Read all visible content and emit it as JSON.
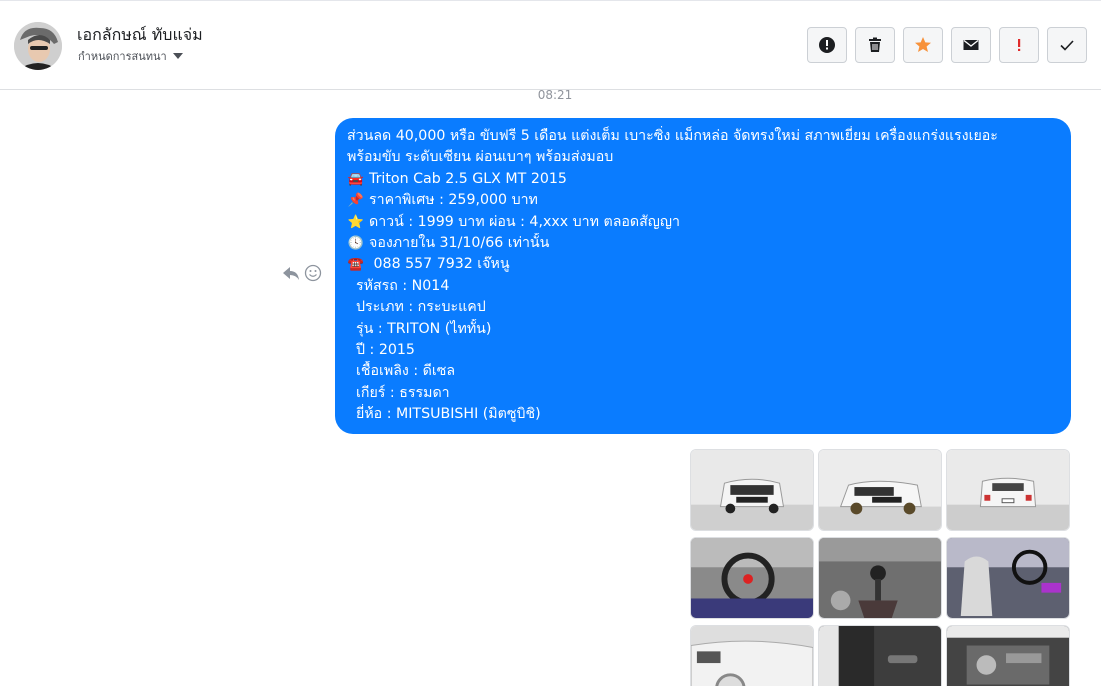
{
  "header": {
    "name": "เอกลักษณ์ ทับแจ่ม",
    "subtitle": "กำหนดการสนทนา"
  },
  "actions": [
    {
      "icon": "alert-circle-icon"
    },
    {
      "icon": "trash-icon"
    },
    {
      "icon": "star-icon",
      "color": "#f7923b"
    },
    {
      "icon": "mail-icon"
    },
    {
      "icon": "important-icon",
      "color": "#e02b2b"
    },
    {
      "icon": "check-icon"
    }
  ],
  "conversation": {
    "time": "08:21",
    "message": {
      "lines": [
        {
          "emoji": "",
          "text": "ส่วนลด 40,000 หรือ ขับฟรี 5 เดือน แต่งเต็ม เบาะซิ่ง แม็กหล่อ จัดทรงใหม่ สภาพเยี่ยม เครื่องแกร่งแรงเยอะ"
        },
        {
          "emoji": "",
          "text": "พร้อมขับ ระดับเซียน ผ่อนเบาๆ พร้อมส่งมอบ"
        },
        {
          "emoji": "🚘",
          "text": "Triton Cab 2.5 GLX MT 2015"
        },
        {
          "emoji": "📌",
          "text": "ราคาพิเศษ : 259,000 บาท"
        },
        {
          "emoji": "⭐",
          "text": "ดาวน์ : 1999 บาท ผ่อน : 4,xxx บาท ตลอดสัญญา"
        },
        {
          "emoji": "🕓",
          "text": "จองภายใน 31/10/66 เท่านั้น"
        },
        {
          "emoji": "☎️",
          "text": " 088 557 7932 เจ๊หนู"
        },
        {
          "emoji": "",
          "text": "  รหัสรถ : N014"
        },
        {
          "emoji": "",
          "text": "  ประเภท : กระบะแคป"
        },
        {
          "emoji": "",
          "text": "  รุ่น : TRITON (ไททั้น)"
        },
        {
          "emoji": "",
          "text": "  ปี : 2015"
        },
        {
          "emoji": "",
          "text": "  เชื้อเพลิง : ดีเซล"
        },
        {
          "emoji": "",
          "text": "  เกียร์ : ธรรมดา"
        },
        {
          "emoji": "",
          "text": "  ยี่ห้อ : MITSUBISHI (มิตซูบิชิ)"
        }
      ]
    },
    "photos": [
      {
        "subject": "truck-front"
      },
      {
        "subject": "truck-front-angle"
      },
      {
        "subject": "truck-rear"
      },
      {
        "subject": "steering-wheel"
      },
      {
        "subject": "gear-shifter"
      },
      {
        "subject": "racing-seats"
      },
      {
        "subject": "side-body"
      },
      {
        "subject": "door-panel"
      },
      {
        "subject": "engine-bay"
      }
    ]
  }
}
